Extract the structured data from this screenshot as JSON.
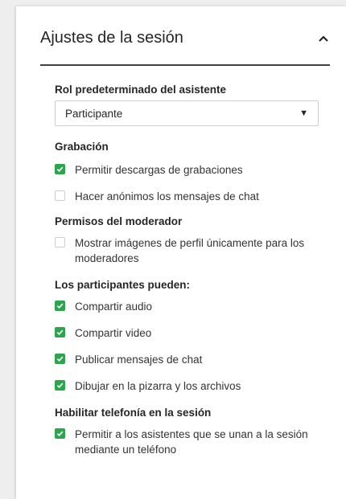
{
  "panel": {
    "title": "Ajustes de la sesión",
    "role_section": {
      "label": "Rol predeterminado del asistente",
      "selected": "Participante"
    },
    "recording_section": {
      "label": "Grabación",
      "options": [
        {
          "label": "Permitir descargas de grabaciones",
          "checked": true
        },
        {
          "label": "Hacer anónimos los mensajes de chat",
          "checked": false
        }
      ]
    },
    "moderator_section": {
      "label": "Permisos del moderador",
      "options": [
        {
          "label": "Mostrar imágenes de perfil únicamente para los moderadores",
          "checked": false
        }
      ]
    },
    "participants_section": {
      "label": "Los participantes pueden:",
      "options": [
        {
          "label": "Compartir audio",
          "checked": true
        },
        {
          "label": "Compartir video",
          "checked": true
        },
        {
          "label": "Publicar mensajes de chat",
          "checked": true
        },
        {
          "label": "Dibujar en la pizarra y los archivos",
          "checked": true
        }
      ]
    },
    "telephony_section": {
      "label": "Habilitar telefonía en la sesión",
      "options": [
        {
          "label": "Permitir a los asistentes que se unan a la sesión mediante un teléfono",
          "checked": true
        }
      ]
    }
  },
  "colors": {
    "accent": "#2ea44f",
    "text": "#262626",
    "divider": "#404040"
  },
  "icons": {
    "collapse": "chevron-up-icon",
    "dropdown": "caret-down-icon",
    "check": "check-icon"
  }
}
